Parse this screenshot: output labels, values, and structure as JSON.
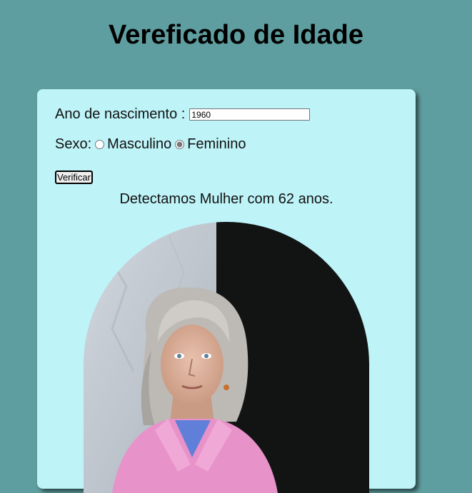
{
  "header": {
    "title": "Vereficado de Idade"
  },
  "form": {
    "year_label": "Ano de nascimento :",
    "year_value": "1960",
    "sex_label": "Sexo:",
    "options": [
      {
        "label": "Masculino",
        "checked": false
      },
      {
        "label": "Feminino",
        "checked": true
      }
    ],
    "verify_label": "Verificar"
  },
  "result": {
    "text": "Detectamos Mulher com 62 anos."
  },
  "colors": {
    "page_background": "#5f9ea0",
    "card_background": "#bef3f8"
  },
  "image": {
    "subject": "portrait of an elderly woman with gray hair in a pink shirt"
  }
}
